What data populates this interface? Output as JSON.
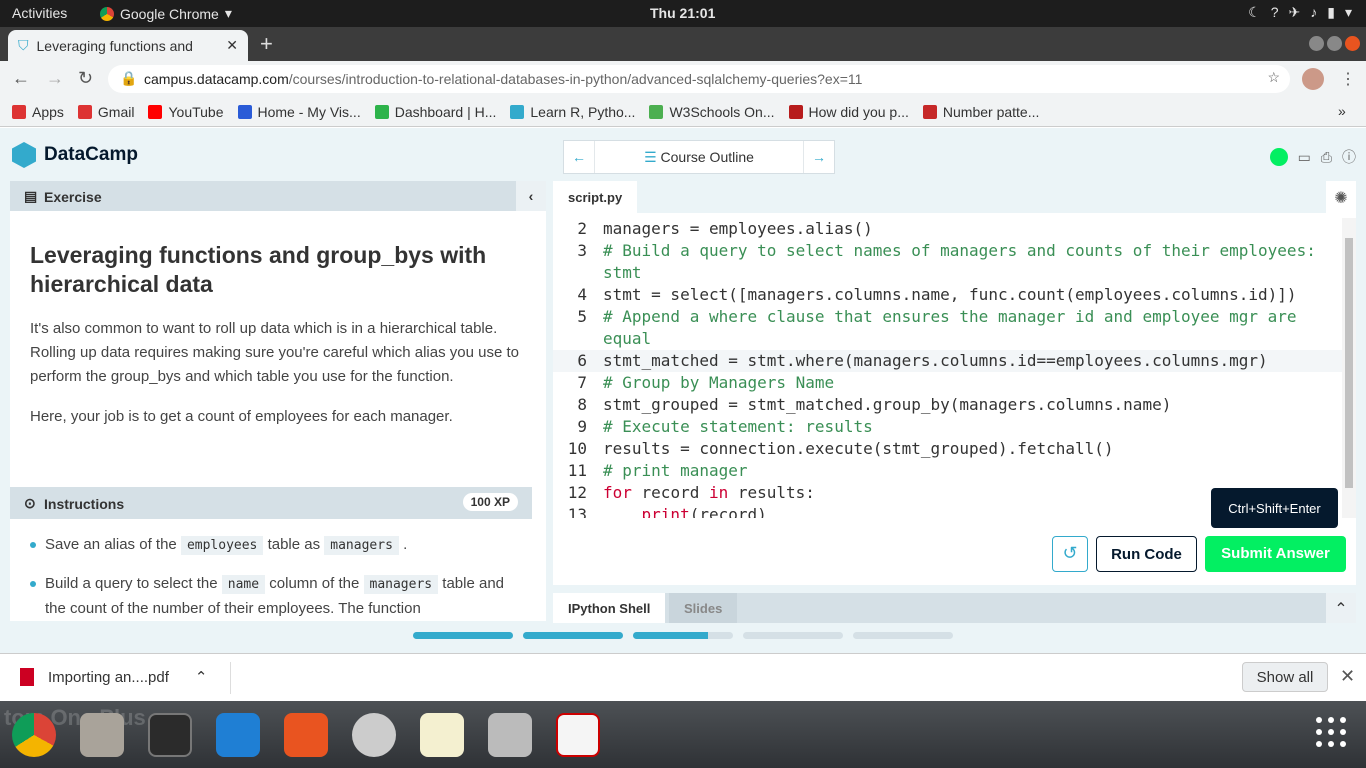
{
  "system": {
    "activities": "Activities",
    "app_name": "Google Chrome",
    "clock": "Thu 21:01"
  },
  "browser": {
    "tab_title": "Leveraging functions and",
    "url_host": "campus.datacamp.com",
    "url_path": "/courses/introduction-to-relational-databases-in-python/advanced-sqlalchemy-queries?ex=11",
    "bookmarks": [
      {
        "label": "Apps",
        "color": "#d33"
      },
      {
        "label": "Gmail",
        "color": "#d33"
      },
      {
        "label": "YouTube",
        "color": "#f00"
      },
      {
        "label": "Home - My Vis...",
        "color": "#2a5bd7"
      },
      {
        "label": "Dashboard | H...",
        "color": "#2db34a"
      },
      {
        "label": "Learn R, Pytho...",
        "color": "#3ac"
      },
      {
        "label": "W3Schools On...",
        "color": "#4caf50"
      },
      {
        "label": "How did you p...",
        "color": "#b71c1c"
      },
      {
        "label": "Number patte...",
        "color": "#c62828"
      }
    ]
  },
  "datacamp": {
    "brand": "DataCamp",
    "course_outline": "Course Outline",
    "exercise_label": "Exercise",
    "title": "Leveraging functions and group_bys with hierarchical data",
    "paragraph1": "It's also common to want to roll up data which is in a hierarchical table. Rolling up data requires making sure you're careful which alias you use to perform the group_bys and which table you use for the function.",
    "paragraph2": "Here, your job is to get a count of employees for each manager.",
    "instructions_label": "Instructions",
    "xp": "100 XP",
    "instructions": {
      "i1_pre": "Save an alias of the",
      "i1_code1": "employees",
      "i1_mid": "table as",
      "i1_code2": "managers",
      "i1_post": ".",
      "i2_pre": "Build a query to select the",
      "i2_code1": "name",
      "i2_mid": "column of the",
      "i2_code2": "managers",
      "i2_post": "table and the count of the number of their employees. The function"
    },
    "editor_tab": "script.py",
    "code_lines": [
      {
        "num": "2",
        "text": "managers = employees.alias()",
        "kind": "code"
      },
      {
        "num": "3",
        "text": "# Build a query to select names of managers and counts of their employees: stmt",
        "kind": "comment"
      },
      {
        "num": "4",
        "text": "stmt = select([managers.columns.name, func.count(employees.columns.id)])",
        "kind": "code"
      },
      {
        "num": "5",
        "text": "# Append a where clause that ensures the manager id and employee mgr are equal",
        "kind": "comment"
      },
      {
        "num": "6",
        "text": "stmt_matched = stmt.where(managers.columns.id==employees.columns.mgr)",
        "kind": "active"
      },
      {
        "num": "7",
        "text": "# Group by Managers Name",
        "kind": "comment"
      },
      {
        "num": "8",
        "text": "stmt_grouped = stmt_matched.group_by(managers.columns.name)",
        "kind": "code"
      },
      {
        "num": "9",
        "text": "# Execute statement: results",
        "kind": "comment"
      },
      {
        "num": "10",
        "text": "results = connection.execute(stmt_grouped).fetchall()",
        "kind": "code"
      },
      {
        "num": "11",
        "text": "# print manager",
        "kind": "comment"
      },
      {
        "num": "12",
        "text": "for record in results:",
        "kind": "keyword"
      },
      {
        "num": "13",
        "text": "    print(record)",
        "kind": "keyword"
      }
    ],
    "tooltip": "Ctrl+Shift+Enter",
    "run_code": "Run Code",
    "submit_answer": "Submit Answer",
    "shell_tab": "IPython Shell",
    "slides_tab": "Slides",
    "progress": [
      1.0,
      1.0,
      0.75,
      0,
      0
    ]
  },
  "downloads": {
    "file": "Importing an....pdf",
    "show_all": "Show all"
  },
  "dock": {
    "ghost_text": "tom One Plus"
  }
}
